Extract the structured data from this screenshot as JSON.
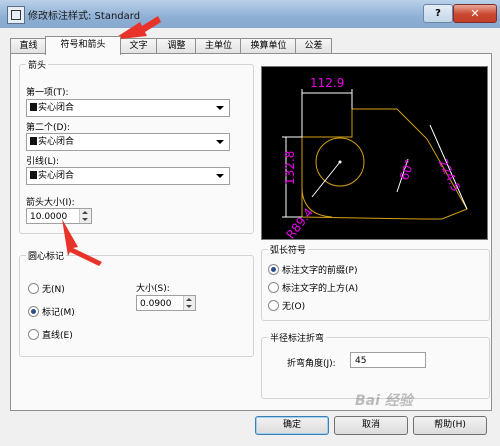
{
  "window": {
    "title": "修改标注样式: Standard",
    "help_label": "?",
    "close_label": "✕"
  },
  "tabs": [
    {
      "label": "直线"
    },
    {
      "label": "符号和箭头"
    },
    {
      "label": "文字"
    },
    {
      "label": "调整"
    },
    {
      "label": "主单位"
    },
    {
      "label": "换算单位"
    },
    {
      "label": "公差"
    }
  ],
  "arrowheads": {
    "title": "箭头",
    "first_label": "第一项(T):",
    "first_value": "实心闭合",
    "second_label": "第二个(D):",
    "second_value": "实心闭合",
    "leader_label": "引线(L):",
    "leader_value": "实心闭合",
    "size_label": "箭头大小(I):",
    "size_value": "10.0000"
  },
  "center_marks": {
    "title": "圆心标记",
    "options": [
      {
        "label": "无(N)",
        "checked": false
      },
      {
        "label": "标记(M)",
        "checked": true
      },
      {
        "label": "直线(E)",
        "checked": false
      }
    ],
    "size_label": "大小(S):",
    "size_value": "0.0900"
  },
  "arc_symbol": {
    "title": "弧长符号",
    "options": [
      {
        "label": "标注文字的前缀(P)",
        "checked": true
      },
      {
        "label": "标注文字的上方(A)",
        "checked": false
      },
      {
        "label": "无(O)",
        "checked": false
      }
    ]
  },
  "jog": {
    "title": "半径标注折弯",
    "angle_label": "折弯角度(J):",
    "angle_value": "45"
  },
  "preview": {
    "dims": {
      "top": "112.9",
      "left": "132.8",
      "right": "224.5",
      "angle": "60°",
      "radius": "R89.4"
    },
    "colors": {
      "geometry": "#d4a017",
      "dimension": "#ffffff",
      "text": "#e600e6"
    }
  },
  "buttons": {
    "ok": "确定",
    "cancel": "取消",
    "help": "帮助(H)"
  },
  "watermark": "Bai 经验"
}
